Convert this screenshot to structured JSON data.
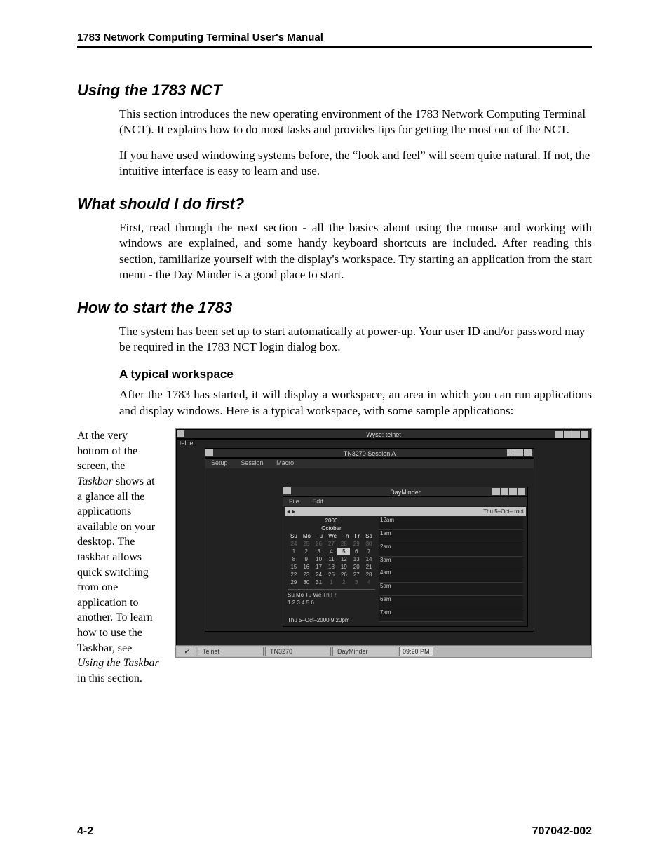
{
  "header": {
    "running": "1783 Network Computing Terminal User's Manual"
  },
  "sections": {
    "s1": {
      "title": "Using the 1783 NCT",
      "p1": "This section introduces the new operating environment of the 1783 Network Computing Terminal (NCT). It explains how to do most tasks and provides tips for getting the most out of the NCT.",
      "p2": "If you have used windowing systems before, the “look and feel” will seem quite natural. If not, the intuitive interface is easy to learn and use."
    },
    "s2": {
      "title": "What should I do first?",
      "p1": "First, read through the next section - all the basics about using the mouse and working with windows are explained, and some handy keyboard shortcuts are included. After reading this section, familiarize yourself with the display's workspace. Try starting an application from the start menu - the Day Minder is a good place to start."
    },
    "s3": {
      "title": "How to start the 1783",
      "p1": "The system has been set up to start automatically at power-up. Your user ID and/or password may be required in the 1783 NCT login dialog box.",
      "sub1": {
        "title": "A typical workspace",
        "p1": "After the 1783 has started, it will display a workspace, an area in which you can run applications and display windows. Here is a typical workspace, with some sample applications:"
      }
    }
  },
  "side_text": {
    "t1": "At the very bottom of the screen, the ",
    "em1": "Taskbar",
    "t2": " shows at a glance all the applications available on your desktop. The taskbar allows quick switching from one application to another. To learn how to use the Taskbar, see ",
    "em2": "Using the Taskbar",
    "t3": " in this section."
  },
  "screenshot": {
    "main_title": "Wyse: telnet",
    "telnet_label": "telnet",
    "session_title": "TN3270 Session A",
    "session_menu": {
      "m1": "Setup",
      "m2": "Session",
      "m3": "Macro"
    },
    "dayminder": {
      "title": "DayMinder",
      "menu": {
        "m1": "File",
        "m2": "Edit"
      },
      "toolbar_date": "Thu  5–Oct– root",
      "year": "2000",
      "month": "October",
      "dow": {
        "d0": "Su",
        "d1": "Mo",
        "d2": "Tu",
        "d3": "We",
        "d4": "Th",
        "d5": "Fr",
        "d6": "Sa"
      },
      "days": {
        "r0": [
          "24",
          "25",
          "26",
          "27",
          "28",
          "29",
          "30"
        ],
        "r1": [
          "1",
          "2",
          "3",
          "4",
          "5",
          "6",
          "7"
        ],
        "r2": [
          "8",
          "9",
          "10",
          "11",
          "12",
          "13",
          "14"
        ],
        "r3": [
          "15",
          "16",
          "17",
          "18",
          "19",
          "20",
          "21"
        ],
        "r4": [
          "22",
          "23",
          "24",
          "25",
          "26",
          "27",
          "28"
        ],
        "r5": [
          "29",
          "30",
          "31",
          "1",
          "2",
          "3",
          "4"
        ]
      },
      "weektabs": {
        "l": "Su Mo Tu We Th Fr",
        "n": "1  2  3  4  5  6"
      },
      "status": "Thu  5–Oct–2000  9:20pm",
      "hours": {
        "h0": "12am",
        "h1": "1am",
        "h2": "2am",
        "h3": "3am",
        "h4": "4am",
        "h5": "5am",
        "h6": "6am",
        "h7": "7am"
      }
    },
    "taskbar": {
      "start": "✔",
      "b1": "Telnet",
      "b2": "TN3270",
      "b3": "DayMinder",
      "clock": "09:20 PM"
    }
  },
  "footer": {
    "page": "4-2",
    "doc": "707042-002"
  }
}
